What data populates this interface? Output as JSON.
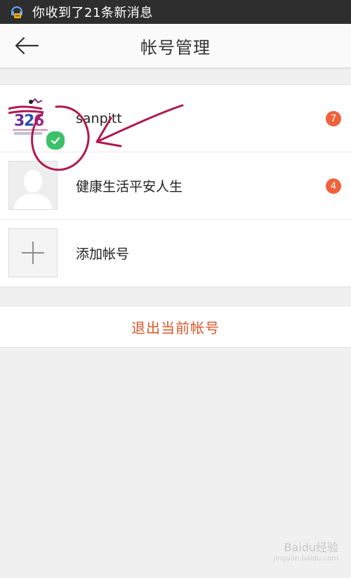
{
  "status_bar": {
    "notification_text": "你收到了21条新消息",
    "icon": "chat-notification-icon"
  },
  "nav": {
    "title": "帐号管理",
    "back_icon": "back-arrow-icon"
  },
  "accounts": [
    {
      "name": "sanpitt",
      "badge": "7",
      "active": true
    },
    {
      "name": "健康生活平安人生",
      "badge": "4",
      "active": false
    }
  ],
  "add_account_label": "添加帐号",
  "logout_label": "退出当前帐号",
  "colors": {
    "badge": "#f0613a",
    "logout_text": "#d9582b",
    "check": "#3cc06a",
    "annotation": "#b0194f"
  },
  "watermark": {
    "brand": "Baidu经验",
    "url": "jingyan.baidu.com"
  }
}
